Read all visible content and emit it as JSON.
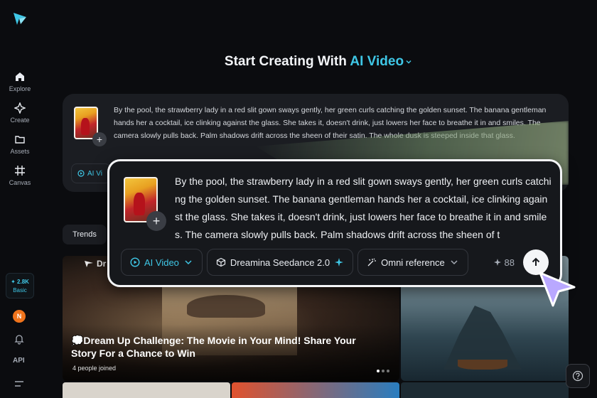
{
  "sidebar": {
    "items": [
      {
        "label": "Explore",
        "icon": "home-icon"
      },
      {
        "label": "Create",
        "icon": "sparkle-icon"
      },
      {
        "label": "Assets",
        "icon": "folder-icon"
      },
      {
        "label": "Canvas",
        "icon": "canvas-icon"
      }
    ],
    "credits": "2.8K",
    "plan": "Basic",
    "avatar_initial": "N",
    "api_label": "API"
  },
  "header": {
    "title_prefix": "Start Creating With",
    "title_mode": "AI Video"
  },
  "prompt": {
    "text": "By the pool, the strawberry lady in a red slit gown sways gently, her green curls catching the golden sunset. The banana gentleman hands her a cocktail, ice clinking against the glass. She takes it, doesn't drink, just lowers her face to breathe it in and smiles. The camera slowly pulls back. Palm shadows drift across the sheen of their satin. The whole dusk is steeped inside that glass.",
    "small_pill_label": "AI Vi"
  },
  "zoom": {
    "text": "By the pool, the strawberry lady in a red slit gown sways gently, her green curls catching the golden sunset. The banana gentleman hands her a cocktail, ice clinking against the glass. She takes it, doesn't drink, just lowers her face to breathe it in and smiles. The camera slowly pulls back. Palm shadows drift across the sheen of t",
    "mode_label": "AI Video",
    "model_label": "Dreamina Seedance 2.0",
    "reference_label": "Omni reference",
    "cost": "88"
  },
  "feed": {
    "tab_label": "Trends",
    "banner_brand": "Dr",
    "banner_title": "💭Dream Up Challenge: The Movie in Your Mind! Share Your Story For a Chance to Win",
    "banner_joined": "4 people joined"
  },
  "colors": {
    "accent": "#3fc7e6",
    "background": "#0b0c0f",
    "card": "#1b1d22"
  }
}
